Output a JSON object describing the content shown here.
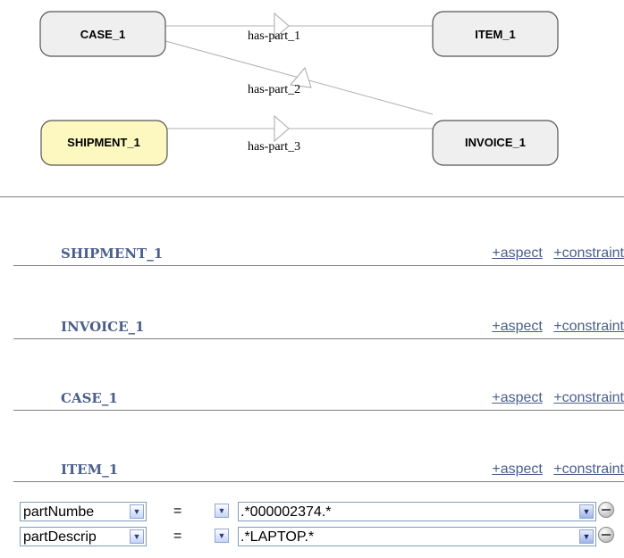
{
  "diagram": {
    "nodes": {
      "case": "CASE_1",
      "item": "ITEM_1",
      "shipment": "SHIPMENT_1",
      "invoice": "INVOICE_1"
    },
    "edges": {
      "e1": "has-part_1",
      "e2": "has-part_2",
      "e3": "has-part_3"
    },
    "colors": {
      "node_fill": "#efefef",
      "highlight_fill": "#fcf8bf",
      "node_border": "#555555"
    }
  },
  "entities": [
    {
      "title": "SHIPMENT_1",
      "aspect_label": "+aspect",
      "constraint_label": "+constraint"
    },
    {
      "title": "INVOICE_1",
      "aspect_label": "+aspect",
      "constraint_label": "+constraint"
    },
    {
      "title": "CASE_1",
      "aspect_label": "+aspect",
      "constraint_label": "+constraint"
    },
    {
      "title": "ITEM_1",
      "aspect_label": "+aspect",
      "constraint_label": "+constraint"
    }
  ],
  "constraints": [
    {
      "field": "partNumbe",
      "operator": "=",
      "value": ".*000002374.*"
    },
    {
      "field": "partDescrip",
      "operator": "=",
      "value": ".*LAPTOP.*"
    }
  ],
  "icons": {
    "dropdown": "chevron-down-icon",
    "remove": "remove-icon"
  }
}
